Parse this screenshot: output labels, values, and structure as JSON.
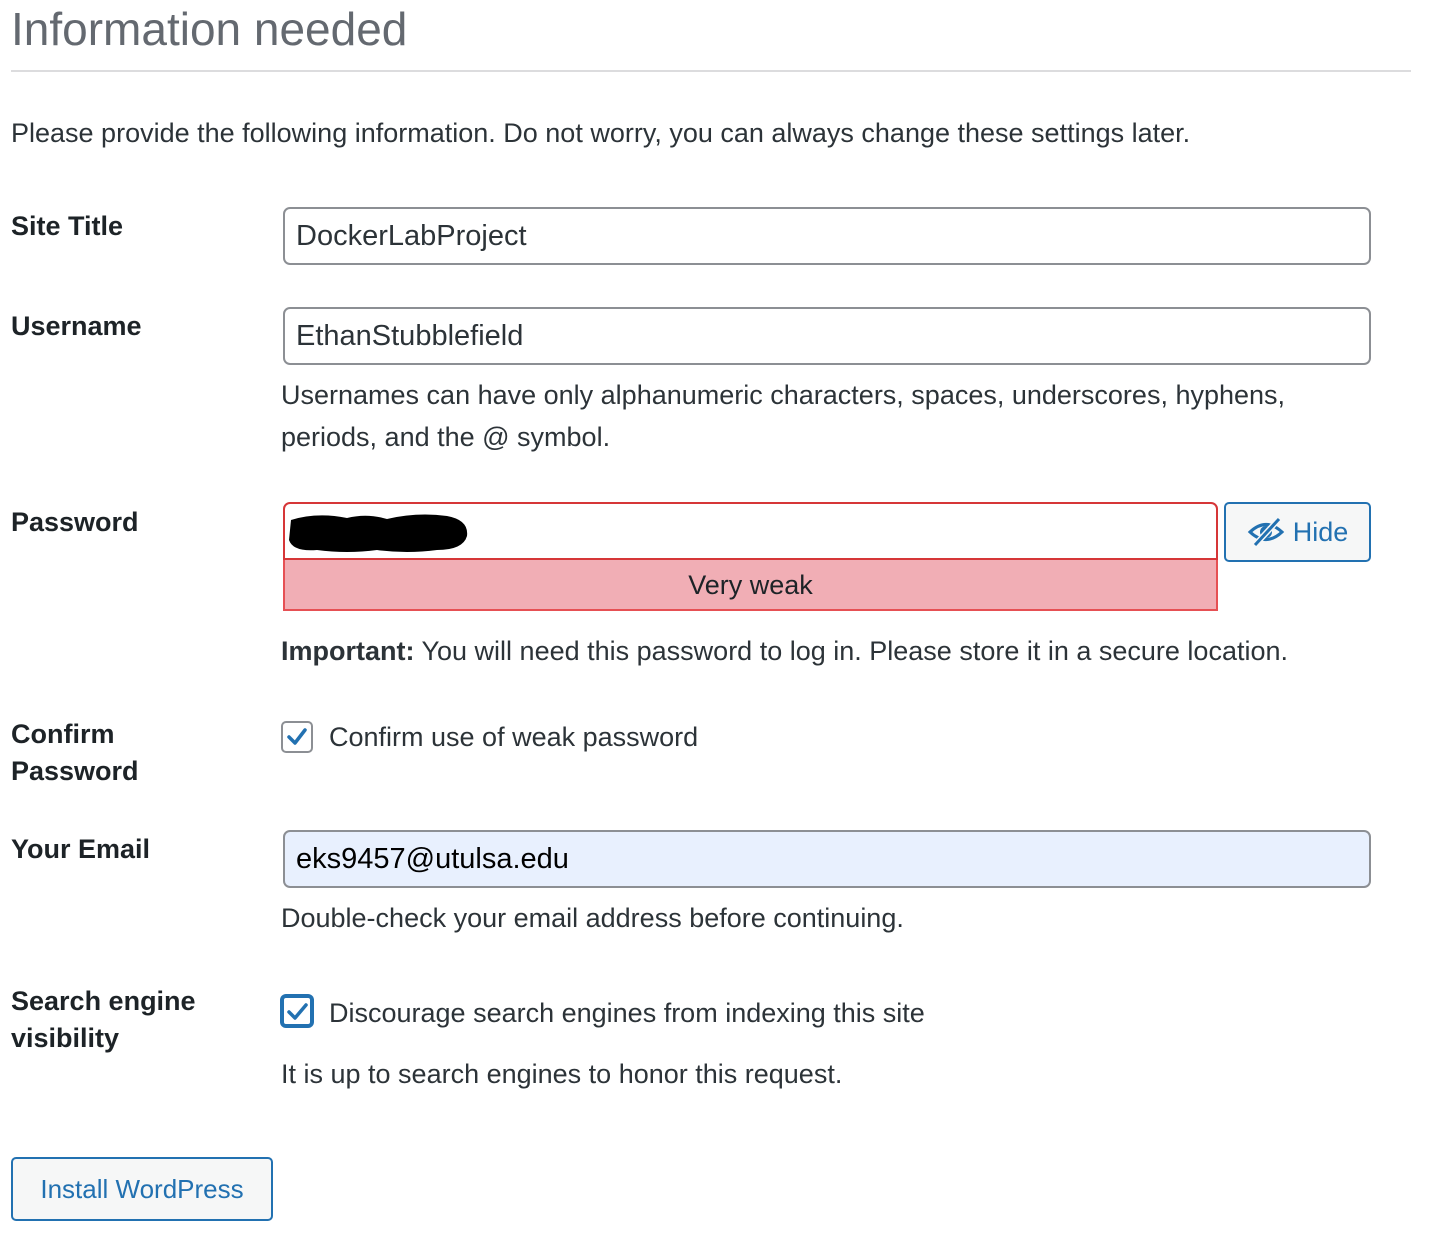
{
  "heading": "Information needed",
  "intro": "Please provide the following information. Do not worry, you can always change these settings later.",
  "site_title": {
    "label": "Site Title",
    "value": "DockerLabProject"
  },
  "username": {
    "label": "Username",
    "value": "EthanStubblefield",
    "description_line1": "Usernames can have only alphanumeric characters, spaces, underscores, hyphens,",
    "description_line2": "periods, and the @ symbol."
  },
  "password": {
    "label": "Password",
    "strength": "Very weak",
    "hide_button": "Hide",
    "hide_icon": "eye-slash-icon",
    "important_label": "Important:",
    "important_text": " You will need this password to log in. Please store it in a secure location."
  },
  "confirm_password": {
    "label_line1": "Confirm",
    "label_line2": "Password",
    "checkbox_label": "Confirm use of weak password",
    "checked": true
  },
  "email": {
    "label": "Your Email",
    "value": "eks9457@utulsa.edu",
    "description": "Double-check your email address before continuing."
  },
  "search_visibility": {
    "label_line1": "Search engine",
    "label_line2": "visibility",
    "checkbox_label": "Discourage search engines from indexing this site",
    "checked": true,
    "description": "It is up to search engines to honor this request."
  },
  "install_button": "Install WordPress",
  "colors": {
    "accent": "#2271b1",
    "error": "#d63638",
    "strength_bg": "#f1aeb5",
    "autofill_bg": "#e8f0fe"
  }
}
